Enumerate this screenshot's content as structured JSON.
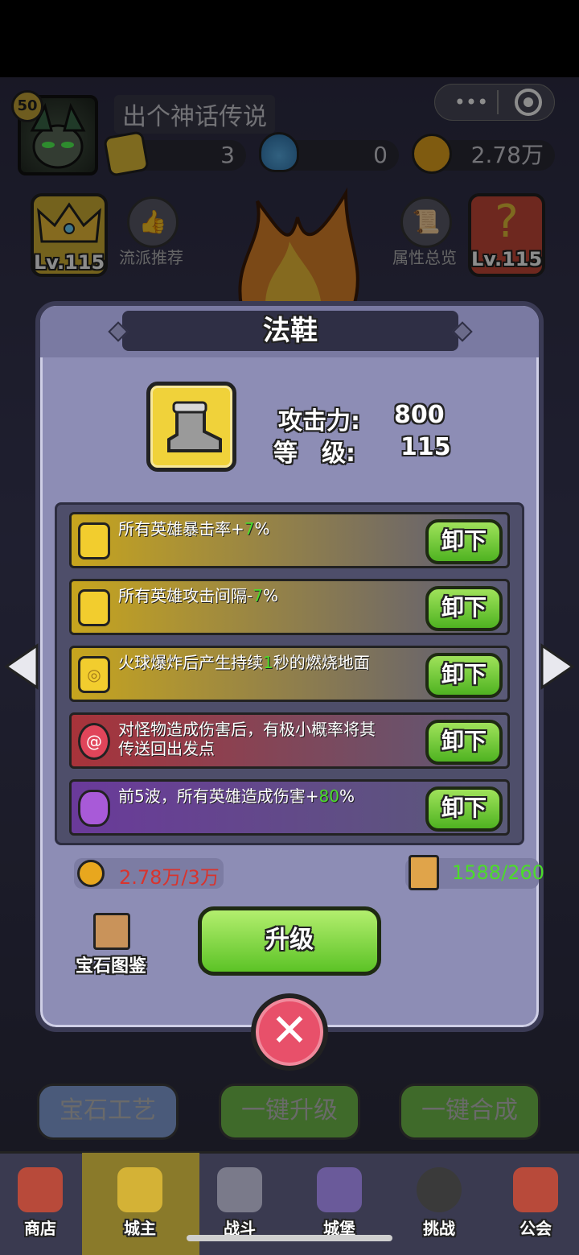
{
  "player": {
    "level": "50",
    "name": "出个神话传说"
  },
  "resources": [
    {
      "icon": "gold-gem-icon",
      "value": "3"
    },
    {
      "icon": "potion-icon",
      "value": "0"
    },
    {
      "icon": "coin-icon",
      "value": "2.78万"
    }
  ],
  "side_left": {
    "level": "Lv.115",
    "label": "流派推荐"
  },
  "side_right": {
    "level": "Lv.115",
    "label": "属性总览"
  },
  "modal": {
    "title": "法鞋",
    "stats": [
      {
        "label": "攻击力:",
        "value": "800"
      },
      {
        "label": "等　级:",
        "value": "115"
      }
    ],
    "slots": [
      {
        "text_before": "所有英雄暴击率+",
        "highlight": "7",
        "text_after": "%",
        "line2": "",
        "gem": "gold",
        "button": "卸下"
      },
      {
        "text_before": "所有英雄攻击间隔-",
        "highlight": "7",
        "text_after": "%",
        "line2": "",
        "gem": "gold",
        "button": "卸下"
      },
      {
        "text_before": "火球爆炸后产生持续",
        "highlight": "1",
        "text_after": "秒的燃烧地面",
        "line2": "",
        "gem": "gold-swirl",
        "button": "卸下"
      },
      {
        "text_before": "对怪物造成伤害后，有极小概率将其",
        "highlight": "",
        "text_after": "",
        "line2": "传送回出发点",
        "gem": "red",
        "button": "卸下"
      },
      {
        "text_before": "前5波，所有英雄造成伤害+",
        "highlight": "80",
        "text_after": "%",
        "line2": "",
        "gem": "purple",
        "button": "卸下"
      }
    ],
    "coin_cost": "2.78万/3万",
    "scroll_cost": "1588/260",
    "codex_label": "宝石图鉴",
    "upgrade_label": "升级"
  },
  "bottom_buttons": [
    "宝石工艺",
    "一键升级",
    "一键合成"
  ],
  "nav": [
    "商店",
    "城主",
    "战斗",
    "城堡",
    "挑战",
    "公会"
  ],
  "colors": {
    "accent_green": "#4cdc2a",
    "modal_bg": "#8d8db5",
    "gold": "#f0d23a",
    "close_red": "#e8506a"
  }
}
